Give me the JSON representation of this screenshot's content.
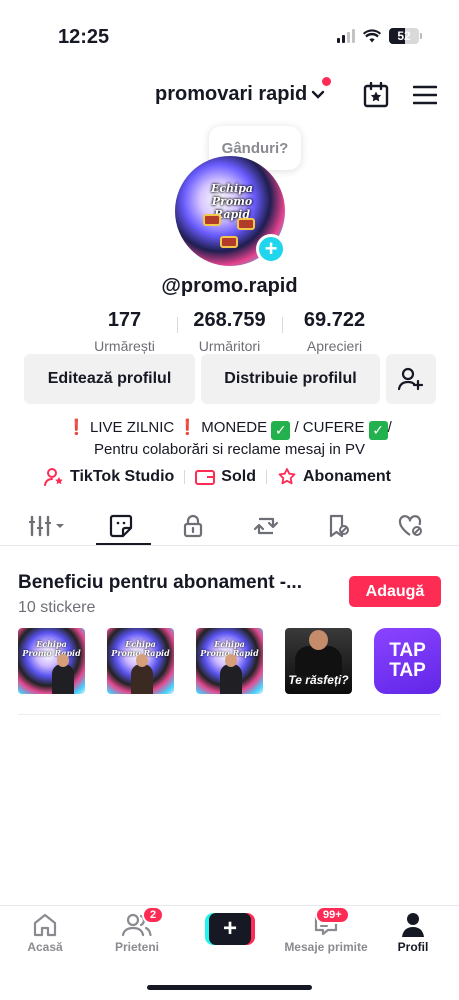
{
  "status_bar": {
    "time": "12:25",
    "battery": "52"
  },
  "header": {
    "account_name": "promovari rapid"
  },
  "bubble": {
    "text": "Gânduri?"
  },
  "avatar": {
    "logo_line1": "Echipa",
    "logo_line2": "Promo Rapid"
  },
  "profile": {
    "username": "@promo.rapid",
    "stats": [
      {
        "value": "177",
        "label": "Urmărești"
      },
      {
        "value": "268.759",
        "label": "Urmăritori"
      },
      {
        "value": "69.722",
        "label": "Aprecieri"
      }
    ]
  },
  "buttons": {
    "edit": "Editează profilul",
    "share": "Distribuie profilul"
  },
  "bio": {
    "line1_part1": "LIVE ZILNIC",
    "line1_part2": "MONEDE",
    "line1_part3": "/ CUFERE",
    "line1_part4": "/",
    "line2": "Pentru colaborări si reclame mesaj in PV"
  },
  "links": {
    "studio": "TikTok Studio",
    "balance": "Sold",
    "subscription": "Abonament"
  },
  "subscription_section": {
    "title": "Beneficiu pentru abonament -...",
    "count": "10 stickere",
    "add_label": "Adaugă",
    "sticker_texts": {
      "dark": "Te răsfeți?",
      "tap_line1": "TAP",
      "tap_line2": "TAP"
    }
  },
  "nav": {
    "home": "Acasă",
    "friends": "Prieteni",
    "friends_badge": "2",
    "inbox": "Mesaje primite",
    "inbox_badge": "99+",
    "profile": "Profil"
  },
  "colors": {
    "accent": "#fe2c55",
    "cyan": "#20d5ec",
    "text": "#161823",
    "muted": "#6e6f76"
  }
}
